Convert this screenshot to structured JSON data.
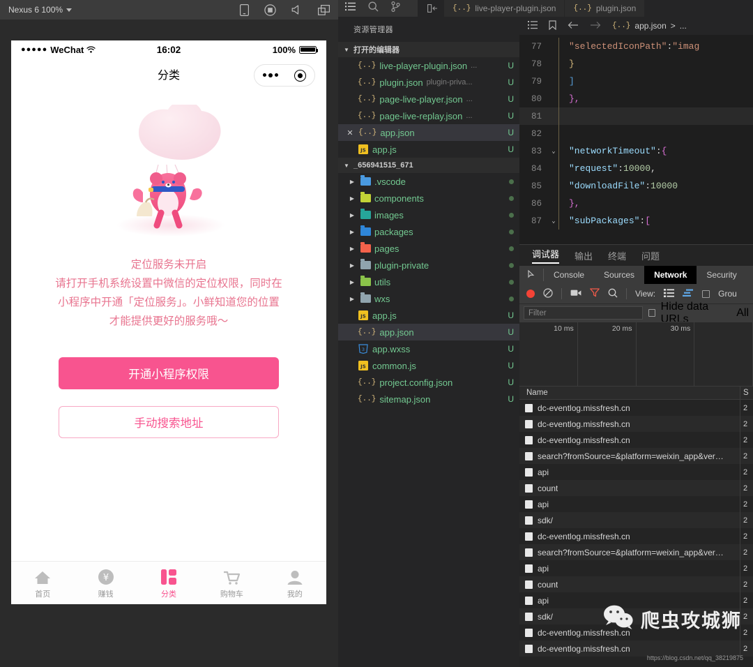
{
  "simulator": {
    "toolbar": {
      "device_label": "Nexus 6 100%",
      "icons": [
        "phone-rotate-icon",
        "record-icon",
        "volume-icon",
        "window-icon"
      ]
    },
    "status_bar": {
      "signal": "●●●●●",
      "carrier": "WeChat",
      "wifi": "wifi-icon",
      "time": "16:02",
      "battery_percent": "100%"
    },
    "nav": {
      "title": "分类",
      "capsule": "capsule-menu"
    },
    "message": {
      "line1": "定位服务未开启",
      "line2": "请打开手机系统设置中微信的定位权限，同时在",
      "line3": "小程序中开通「定位服务」。小鲜知道您的位置",
      "line4": "才能提供更好的服务哦～"
    },
    "buttons": {
      "primary": "开通小程序权限",
      "secondary": "手动搜索地址"
    },
    "tabbar": [
      {
        "label": "首页",
        "icon": "home-icon",
        "active": false
      },
      {
        "label": "赚钱",
        "icon": "yuan-coin-icon",
        "active": false
      },
      {
        "label": "分类",
        "icon": "grid-category-icon",
        "active": true
      },
      {
        "label": "购物车",
        "icon": "cart-icon",
        "active": false
      },
      {
        "label": "我的",
        "icon": "person-icon",
        "active": false
      }
    ],
    "colors": {
      "accent": "#f8548f",
      "text": "#e8748f"
    }
  },
  "ide": {
    "activity_icons": [
      "explorer-icon",
      "search-icon",
      "source-control-icon"
    ],
    "editor_tabs": [
      {
        "label": "live-player-plugin.json",
        "icon": "json-icon",
        "active": false
      },
      {
        "label": "plugin.json",
        "icon": "json-icon",
        "active": false
      }
    ],
    "split_icon": "split-editor-icon",
    "breadcrumb": {
      "icons": [
        "outline-icon",
        "bookmark-icon",
        "back-arrow-icon",
        "forward-arrow-icon"
      ],
      "file": "app.json",
      "separator": ">",
      "rest": "..."
    },
    "explorer": {
      "title": "资源管理器",
      "open_editors_label": "打开的编辑器",
      "open_editors": [
        {
          "name": "live-player-plugin.json",
          "detail": "...",
          "flag": "U",
          "icon": "json-icon",
          "selected": false,
          "closable": false
        },
        {
          "name": "plugin.json",
          "detail": "plugin-priva...",
          "flag": "U",
          "icon": "json-icon",
          "selected": false,
          "closable": false
        },
        {
          "name": "page-live-player.json",
          "detail": "...",
          "flag": "U",
          "icon": "json-icon",
          "selected": false,
          "closable": false
        },
        {
          "name": "page-live-replay.json",
          "detail": "...",
          "flag": "U",
          "icon": "json-icon",
          "selected": false,
          "closable": false
        },
        {
          "name": "app.json",
          "detail": "",
          "flag": "U",
          "icon": "json-icon",
          "selected": true,
          "closable": true
        },
        {
          "name": "app.js",
          "detail": "",
          "flag": "U",
          "icon": "js-icon",
          "selected": false,
          "closable": false
        }
      ],
      "project_label": "_656941515_671",
      "tree": [
        {
          "name": ".vscode",
          "type": "folder",
          "icon": "folder-vscode-icon",
          "color": "#4a9ae1",
          "flag": "dot",
          "selected": false
        },
        {
          "name": "components",
          "type": "folder",
          "icon": "folder-components-icon",
          "color": "#c3d337",
          "flag": "dot",
          "selected": false
        },
        {
          "name": "images",
          "type": "folder",
          "icon": "folder-images-icon",
          "color": "#26a69a",
          "flag": "dot",
          "selected": false
        },
        {
          "name": "packages",
          "type": "folder",
          "icon": "folder-packages-icon",
          "color": "#2f86d8",
          "flag": "dot",
          "selected": false
        },
        {
          "name": "pages",
          "type": "folder",
          "icon": "folder-pages-icon",
          "color": "#f4624b",
          "flag": "dot",
          "selected": false
        },
        {
          "name": "plugin-private",
          "type": "folder",
          "icon": "folder-icon",
          "color": "#90a4ae",
          "flag": "dot",
          "selected": false
        },
        {
          "name": "utils",
          "type": "folder",
          "icon": "folder-utils-icon",
          "color": "#8bc34a",
          "flag": "dot",
          "selected": false
        },
        {
          "name": "wxs",
          "type": "folder",
          "icon": "folder-icon",
          "color": "#90a4ae",
          "flag": "dot",
          "selected": false
        },
        {
          "name": "app.js",
          "type": "file",
          "icon": "js-icon",
          "flag": "U",
          "selected": false
        },
        {
          "name": "app.json",
          "type": "file",
          "icon": "json-icon",
          "flag": "U",
          "selected": true
        },
        {
          "name": "app.wxss",
          "type": "file",
          "icon": "css-icon",
          "flag": "U",
          "selected": false
        },
        {
          "name": "common.js",
          "type": "file",
          "icon": "js-icon",
          "flag": "U",
          "selected": false
        },
        {
          "name": "project.config.json",
          "type": "file",
          "icon": "json-icon",
          "flag": "U",
          "selected": false
        },
        {
          "name": "sitemap.json",
          "type": "file",
          "icon": "json-icon",
          "flag": "U",
          "selected": false
        }
      ]
    },
    "code": {
      "lines": [
        {
          "no": "77",
          "fold": "",
          "html": "      <span class='s'>\"selectedIconPath\"</span><span class='p'>:</span> <span class='s'>\"imag</span>",
          "hl": false
        },
        {
          "no": "78",
          "fold": "",
          "html": "    <span class='by'>}</span>",
          "hl": false
        },
        {
          "no": "79",
          "fold": "",
          "html": "  <span class='bb'>]</span>",
          "hl": false
        },
        {
          "no": "80",
          "fold": "",
          "html": "  <span class='br'>},</span>",
          "hl": false
        },
        {
          "no": "81",
          "fold": "",
          "html": "",
          "hl": true
        },
        {
          "no": "82",
          "fold": "",
          "html": "",
          "hl": false
        },
        {
          "no": "83",
          "fold": "⌄",
          "html": "  <span class='k'>\"networkTimeout\"</span><span class='p'>:</span> <span class='br'>{</span>",
          "hl": false
        },
        {
          "no": "84",
          "fold": "",
          "html": "    <span class='k'>\"request\"</span><span class='p'>:</span> <span class='nn'>10000</span><span class='p'>,</span>",
          "hl": false
        },
        {
          "no": "85",
          "fold": "",
          "html": "    <span class='k'>\"downloadFile\"</span><span class='p'>:</span> <span class='nn'>10000</span>",
          "hl": false
        },
        {
          "no": "86",
          "fold": "",
          "html": "  <span class='br'>},</span>",
          "hl": false
        },
        {
          "no": "87",
          "fold": "⌄",
          "html": "  <span class='k'>\"subPackages\"</span><span class='p'>:</span> <span class='br'>[</span>",
          "hl": false
        }
      ]
    },
    "devtools": {
      "panel_tabs": [
        {
          "label": "调试器",
          "active": true
        },
        {
          "label": "输出",
          "active": false
        },
        {
          "label": "终端",
          "active": false
        },
        {
          "label": "问题",
          "active": false
        }
      ],
      "cdp_tabs": [
        {
          "label": "Console",
          "active": false
        },
        {
          "label": "Sources",
          "active": false
        },
        {
          "label": "Network",
          "active": true
        },
        {
          "label": "Security",
          "active": false
        }
      ],
      "inspect_icon": "inspect-element-icon",
      "network_toolbar": {
        "record_icon": "record-stop-icon",
        "clear_icon": "clear-icon",
        "camera_icon": "camera-icon",
        "filter_icon": "filter-icon",
        "search_icon": "search-icon",
        "view_label": "View:",
        "list_icon": "list-view-icon",
        "waterfall_icon": "waterfall-view-icon",
        "group_label": "Grou"
      },
      "filter_row": {
        "placeholder": "Filter",
        "hide_data_urls": "Hide data URLs",
        "all_label": "All"
      },
      "timeline_ticks": [
        "10 ms",
        "20 ms",
        "30 ms"
      ],
      "columns": [
        "Name",
        "S"
      ],
      "requests": [
        "dc-eventlog.missfresh.cn",
        "dc-eventlog.missfresh.cn",
        "dc-eventlog.missfresh.cn",
        "search?fromSource=&platform=weixin_app&ver…",
        "api",
        "count",
        "api",
        "sdk/",
        "dc-eventlog.missfresh.cn",
        "search?fromSource=&platform=weixin_app&ver…",
        "api",
        "count",
        "api",
        "sdk/",
        "dc-eventlog.missfresh.cn",
        "dc-eventlog.missfresh.cn"
      ],
      "size_col": "2"
    }
  },
  "watermark": {
    "text": "爬虫攻城狮",
    "icon": "wechat-icon",
    "url": "https://blog.csdn.net/qq_38219875"
  }
}
